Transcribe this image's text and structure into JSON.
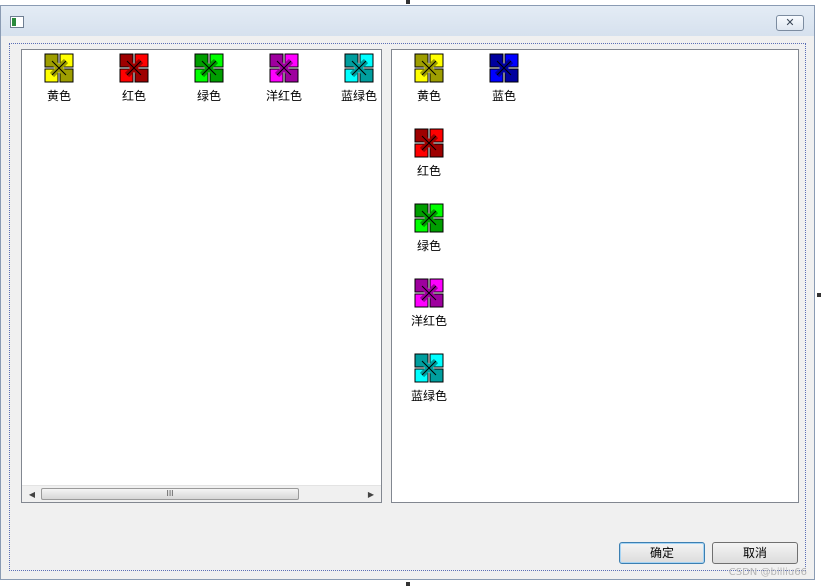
{
  "window": {
    "close_icon": "close-x-icon"
  },
  "left_list": {
    "items": [
      {
        "label": "黄色",
        "color": "#ffff00"
      },
      {
        "label": "红色",
        "color": "#ff0000"
      },
      {
        "label": "绿色",
        "color": "#00ff00"
      },
      {
        "label": "洋红色",
        "color": "#ff00ff"
      },
      {
        "label": "蓝绿色",
        "color": "#00ffff"
      }
    ],
    "scrollbar_thumb": "III"
  },
  "right_list": {
    "items": [
      {
        "label": "黄色",
        "color": "#ffff00"
      },
      {
        "label": "蓝色",
        "color": "#0000ff"
      },
      {
        "label": "红色",
        "color": "#ff0000"
      },
      {
        "label": "绿色",
        "color": "#00ff00"
      },
      {
        "label": "洋红色",
        "color": "#ff00ff"
      },
      {
        "label": "蓝绿色",
        "color": "#00ffff"
      }
    ]
  },
  "buttons": {
    "ok": "确定",
    "cancel": "取消"
  },
  "watermark": "CSDN @billiu66"
}
